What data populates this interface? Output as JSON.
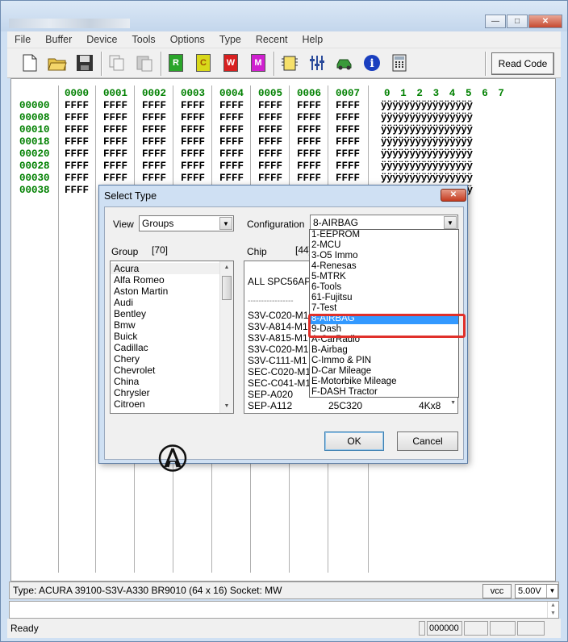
{
  "window": {
    "caption_buttons": [
      "minimize",
      "maximize",
      "close"
    ]
  },
  "menu": [
    "File",
    "Buffer",
    "Device",
    "Tools",
    "Options",
    "Type",
    "Recent",
    "Help"
  ],
  "toolbar": {
    "letters": [
      "R",
      "C",
      "W",
      "M"
    ],
    "letter_colors": [
      "#2aa52a",
      "#d8d81a",
      "#d82020",
      "#d020d0"
    ],
    "read_code_label": "Read Code"
  },
  "hex": {
    "column_headers": [
      "0000",
      "0001",
      "0002",
      "0003",
      "0004",
      "0005",
      "0006",
      "0007"
    ],
    "ascii_header": "0 1 2 3 4 5 6 7",
    "addresses": [
      "00000",
      "00008",
      "00010",
      "00018",
      "00020",
      "00028",
      "00030",
      "00038"
    ],
    "cell_value": "FFFF",
    "ascii_row": "ÿÿÿÿÿÿÿÿÿÿÿÿÿÿÿÿ"
  },
  "dialog": {
    "title": "Select Type",
    "view_label": "View",
    "view_value": "Groups",
    "configuration_label": "Configuration",
    "configuration_value": "8-AIRBAG",
    "group_label": "Group",
    "group_count": "[70]",
    "chip_label": "Chip",
    "chip_count": "[44]",
    "groups": [
      "Acura",
      "Alfa Romeo",
      "Aston Martin",
      "Audi",
      "Bentley",
      "Bmw",
      "Buick",
      "Cadillac",
      "Chery",
      "Chevrolet",
      "China",
      "Chrysler",
      "Citroen"
    ],
    "selected_group": "Acura",
    "chip_header": "ALL  SPC56AP",
    "chip_separator": "-----------------",
    "chips": [
      "S3V-C020-M1",
      "S3V-A814-M1",
      "S3V-A815-M1",
      "S3V-C020-M1",
      "S3V-C111-M1",
      "SEC-C020-M1",
      "SEC-C041-M1",
      "SEP-A020",
      "SEP-A112"
    ],
    "last_chip_type": "25C320",
    "last_chip_size": "4Kx8",
    "ok_label": "OK",
    "cancel_label": "Cancel",
    "logo_icon": "acura-logo"
  },
  "configuration_options": [
    "1-EEPROM",
    "2-MCU",
    "3-O5 Immo",
    "4-Renesas",
    "5-MTRK",
    "6-Tools",
    "61-Fujitsu",
    "7-Test",
    "8-AIRBAG",
    "9-Dash",
    "A-CarRadio",
    "B-Airbag",
    "C-Immo & PIN",
    "D-Car Mileage",
    "E-Motorbike Mileage",
    "F-DASH Tractor"
  ],
  "highlighted_option": "8-AIRBAG",
  "typebar": {
    "text": "Type: ACURA 39100-S3V-A330 BR9010 (64 x 16)   Socket: MW",
    "vcc_label": "vcc",
    "voltage": "5.00V"
  },
  "status": {
    "ready": "Ready",
    "checksum": "000000"
  },
  "colors": {
    "address_green": "#008000",
    "highlight_blue": "#3399ff",
    "annotation_red": "#e0302a"
  }
}
